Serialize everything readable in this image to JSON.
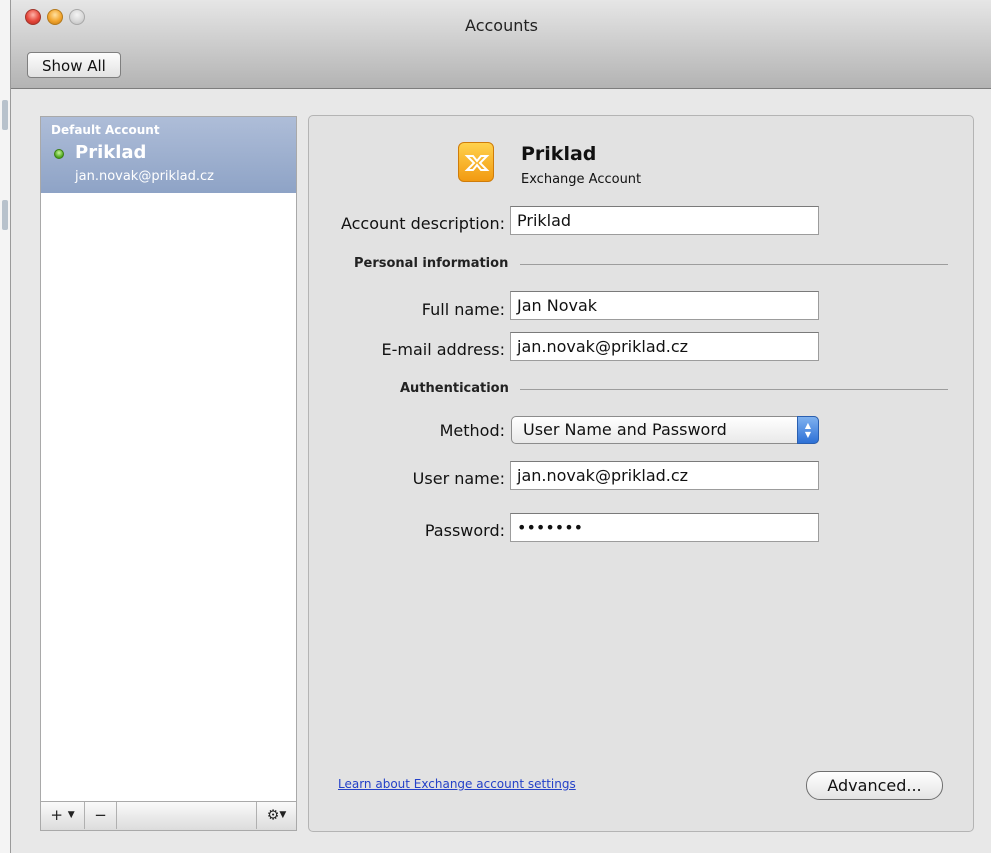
{
  "window": {
    "title": "Accounts"
  },
  "toolbar": {
    "show_all_label": "Show All"
  },
  "sidebar": {
    "accounts": [
      {
        "group": "Default Account",
        "name": "Priklad",
        "email": "jan.novak@priklad.cz",
        "status_color": "#4aa51a"
      }
    ],
    "footer": {
      "add_label": "+",
      "remove_label": "−",
      "gear_icon": "gear-icon"
    }
  },
  "account": {
    "name": "Priklad",
    "type": "Exchange Account",
    "icon": "exchange-icon",
    "description_label": "Account description:",
    "description_value": "Priklad",
    "personal_section": "Personal information",
    "full_name_label": "Full name:",
    "full_name_value": "Jan Novak",
    "email_label": "E-mail address:",
    "email_value": "jan.novak@priklad.cz",
    "auth_section": "Authentication",
    "method_label": "Method:",
    "method_value": "User Name and Password",
    "username_label": "User name:",
    "username_value": "jan.novak@priklad.cz",
    "password_label": "Password:",
    "password_value": "•••••••"
  },
  "footer": {
    "learn_link": "Learn about Exchange account settings",
    "advanced_label": "Advanced..."
  },
  "colors": {
    "selection": "#8ea3c6",
    "link": "#2441c8",
    "accent": "#2d70d6"
  }
}
